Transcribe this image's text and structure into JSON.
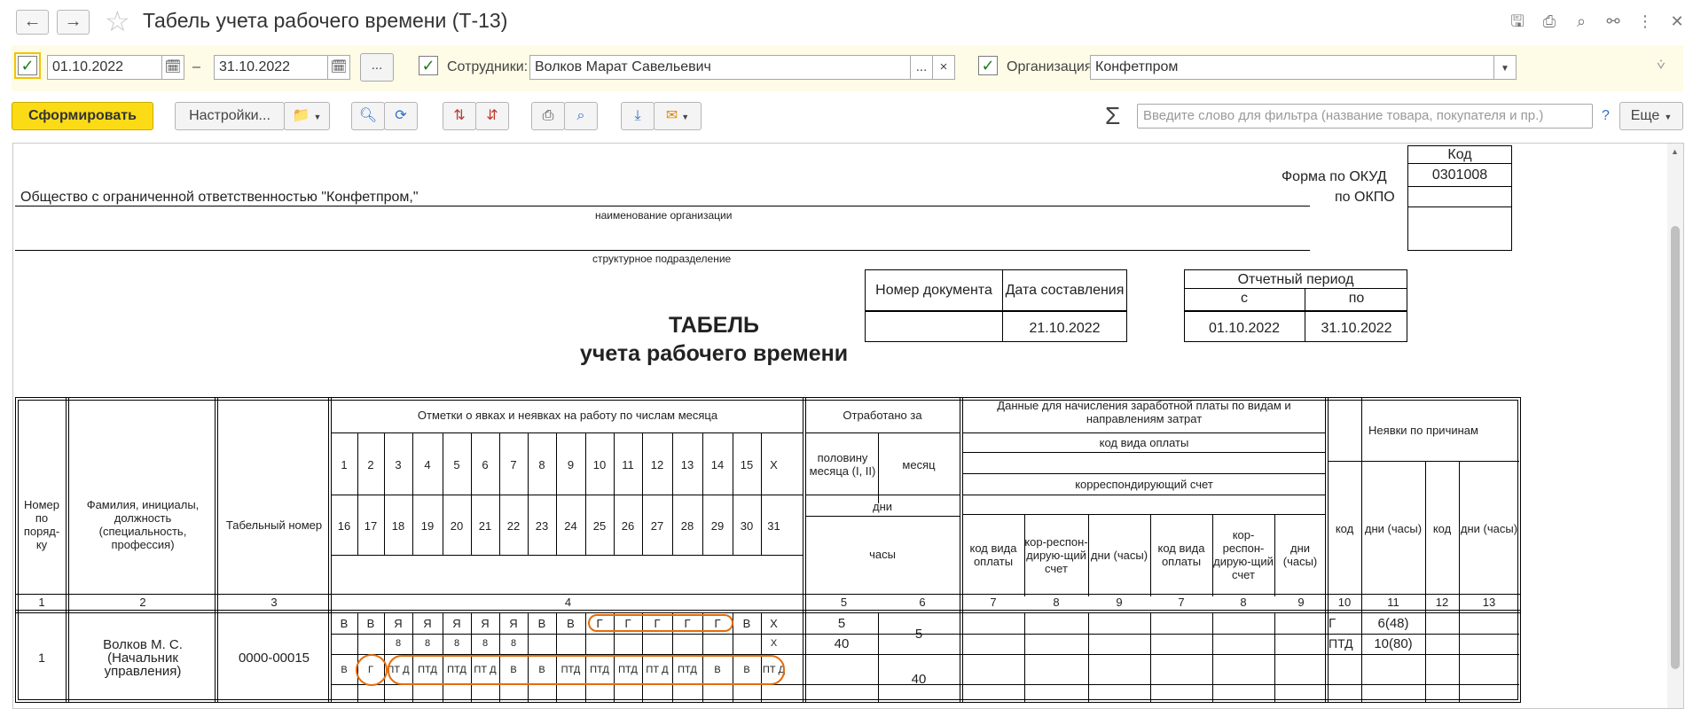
{
  "window": {
    "title": "Табель учета рабочего времени (Т-13)",
    "back_icon": "arrow-left-icon",
    "forward_icon": "arrow-right-icon",
    "favorite_icon": "star-icon"
  },
  "filters": {
    "date_from": "01.10.2022",
    "date_sep": "–",
    "date_to": "31.10.2022",
    "more_label": "...",
    "employees_label": "Сотрудники:",
    "employees_value": "Волков Марат Савельевич",
    "employees_more": "...",
    "employees_clear": "×",
    "org_label": "Организация:",
    "org_value": "Конфетпром"
  },
  "toolbar": {
    "generate_label": "Сформировать",
    "settings_label": "Настройки...",
    "search_placeholder": "Введите слово для фильтра (название товара, покупателя и пр.)",
    "help_label": "?",
    "more_label": "Еще",
    "sigma": "Σ"
  },
  "report": {
    "kod_header": "Код",
    "okud_label": "Форма по ОКУД",
    "okud_value": "0301008",
    "okpo_label": "по ОКПО",
    "org_name": "Общество с ограниченной ответственностью \"Конфетпром,\"",
    "org_caption": "наименование организации",
    "dept_caption": "структурное подразделение",
    "doc_num_header": "Номер документа",
    "doc_date_header": "Дата составления",
    "doc_date_value": "21.10.2022",
    "period_header": "Отчетный период",
    "period_from_label": "с",
    "period_to_label": "по",
    "period_from": "01.10.2022",
    "period_to": "31.10.2022",
    "title1": "ТАБЕЛЬ",
    "title2": "учета  рабочего времени",
    "h_num": "Номер по поряд-ку",
    "h_name": "Фамилия, инициалы, должность (специальность, профессия)",
    "h_tab": "Табельный номер",
    "h_marks": "Отметки о явках и неявках на работу по числам месяца",
    "h_worked": "Отработано за",
    "h_half": "половину месяца (I, II)",
    "h_month": "месяц",
    "h_days": "дни",
    "h_hours": "часы",
    "h_salary": "Данные для начисления заработной платы по видам и направлениям затрат",
    "h_paycode": "код вида оплаты",
    "h_corr": "корреспондирующий счет",
    "h_kvo": "код вида оплаты",
    "h_korr": "кор-респон-дирую-щий счет",
    "h_dch": "дни (часы)",
    "h_absence": "Неявки по причинам",
    "h_code": "код",
    "days_row1": [
      "1",
      "2",
      "3",
      "4",
      "5",
      "6",
      "7",
      "8",
      "9",
      "10",
      "11",
      "12",
      "13",
      "14",
      "15",
      "X"
    ],
    "days_row2": [
      "16",
      "17",
      "18",
      "19",
      "20",
      "21",
      "22",
      "23",
      "24",
      "25",
      "26",
      "27",
      "28",
      "29",
      "30",
      "31"
    ],
    "colnums": [
      "1",
      "2",
      "3",
      "4",
      "5",
      "6",
      "7",
      "8",
      "9",
      "7",
      "8",
      "9",
      "10",
      "11",
      "12",
      "13"
    ],
    "employee": {
      "num": "1",
      "name": "Волков М. С. (Начальник управления)",
      "tab": "0000-00015",
      "marks1": [
        "В",
        "В",
        "Я",
        "Я",
        "Я",
        "Я",
        "Я",
        "В",
        "В",
        "Г",
        "Г",
        "Г",
        "Г",
        "Г",
        "В",
        "Х"
      ],
      "hours1": [
        "",
        "",
        "8",
        "8",
        "8",
        "8",
        "8",
        "",
        "",
        "",
        "",
        "",
        "",
        "",
        "",
        "Х"
      ],
      "marks2": [
        "В",
        "Г",
        "ПТ Д",
        "ПТД",
        "ПТД",
        "ПТ Д",
        "В",
        "В",
        "ПТД",
        "ПТД",
        "ПТД",
        "ПТ Д",
        "ПТД",
        "В",
        "В",
        "ПТ Д"
      ],
      "half1_days": "5",
      "half1_hours": "40",
      "month_days": "5",
      "month_hours": "40",
      "abs1_code": "Г",
      "abs1_days": "6(48)",
      "abs2_code": "ПТД",
      "abs2_days": "10(80)"
    }
  },
  "colors": {
    "accent": "#fbdb16",
    "filter_bg": "#fefbe6",
    "highlight": "#e46c0a",
    "check": "#1f7c1f"
  }
}
